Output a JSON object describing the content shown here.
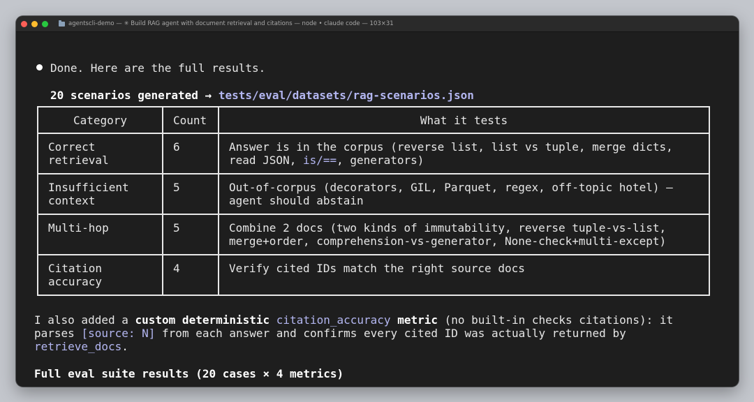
{
  "window": {
    "title": "agentscli-demo — ✳ Build RAG agent with document retrieval and citations — node • claude code — 103×31"
  },
  "messages": {
    "done_line": "Done. Here are the full results.",
    "scenarios_prefix": "20 scenarios generated → ",
    "scenarios_path": "tests/eval/datasets/rag-scenarios.json"
  },
  "table": {
    "headers": [
      "Category",
      "Count",
      "What it tests"
    ],
    "rows": [
      {
        "category": "Correct\nretrieval",
        "count": "6",
        "tests_a": "Answer is in the corpus (reverse list, list vs tuple, merge dicts,\nread JSON, ",
        "tests_code": "is/==",
        "tests_b": ", generators)"
      },
      {
        "category": "Insufficient\ncontext",
        "count": "5",
        "tests": "Out-of-corpus (decorators, GIL, Parquet, regex, off-topic hotel) —\nagent should abstain"
      },
      {
        "category": "Multi-hop",
        "count": "5",
        "tests": "Combine 2 docs (two kinds of immutability, reverse tuple-vs-list,\nmerge+order, comprehension-vs-generator, None-check+multi-except)"
      },
      {
        "category": "Citation\naccuracy",
        "count": "4",
        "tests": "Verify cited IDs match the right source docs"
      }
    ]
  },
  "metric_note": {
    "p1": "I also added a ",
    "b1": "custom deterministic ",
    "c1": "citation_accuracy",
    "b2": " metric",
    "p2": " (no built-in checks citations): it",
    "p3": "parses ",
    "c2": "[source: N]",
    "p4": " from each answer and confirms every cited ID was actually returned by",
    "c3": "retrieve_docs",
    "p5": "."
  },
  "suite_heading": "Full eval suite results (20 cases × 4 metrics)",
  "colors": {
    "background": "#1e1e1e",
    "text": "#e6e6e6",
    "code": "#b3b6f0",
    "border": "#e8e8e8"
  }
}
